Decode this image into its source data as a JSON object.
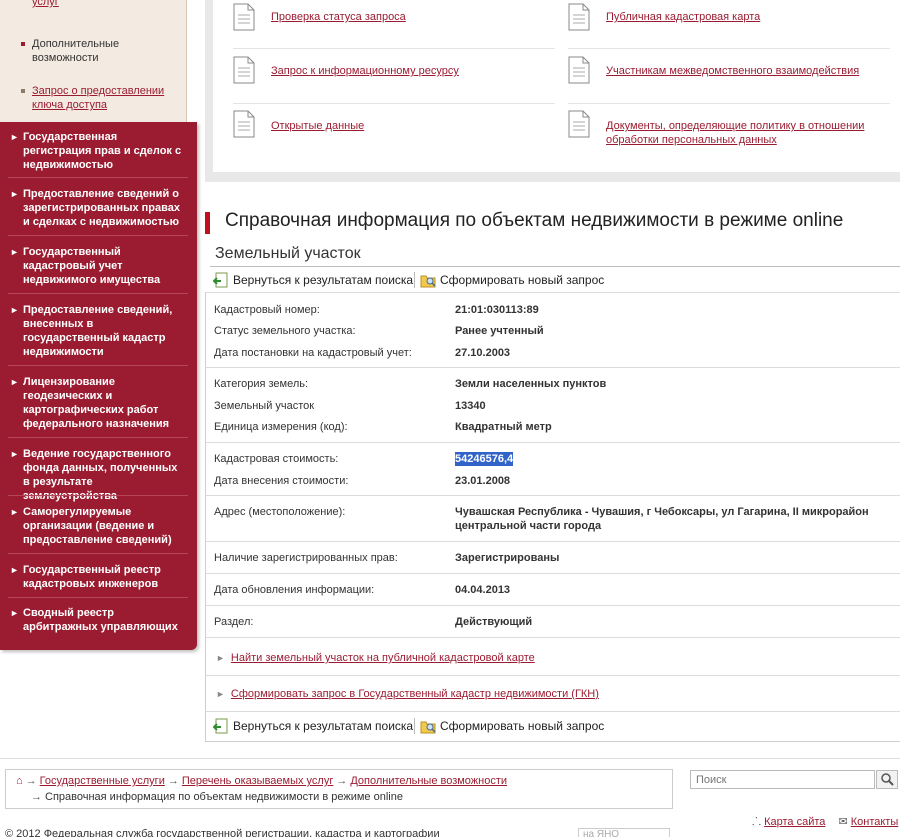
{
  "sidebar": {
    "sub_top_link": "услуг",
    "sub_items": [
      {
        "label": "Дополнительные возможности"
      },
      {
        "label": "Запрос о предоставлении ключа доступа"
      }
    ],
    "nav_items": [
      {
        "label": "Государственная регистрация прав и сделок с недвижимостью"
      },
      {
        "label": "Предоставление сведений о зарегистрированных правах и сделках с недвижимостью"
      },
      {
        "label": "Государственный кадастровый учет недвижимого имущества"
      },
      {
        "label": "Предоставление сведений, внесенных в государственный кадастр недвижимости"
      },
      {
        "label": "Лицензирование геодезических и картографических работ федерального назначения"
      },
      {
        "label": "Ведение государственного фонда данных, полученных в результате землеустройства"
      },
      {
        "label": "Саморегулируемые организации (ведение и предоставление сведений)"
      },
      {
        "label": "Государственный реестр кадастровых инженеров"
      },
      {
        "label": "Сводный реестр арбитражных управляющих"
      }
    ]
  },
  "top_links": [
    {
      "label": "Проверка статуса запроса"
    },
    {
      "label": "Публичная кадастровая карта"
    },
    {
      "label": "Запрос к информационному ресурсу"
    },
    {
      "label": "Участникам межведомственного взаимодействия"
    },
    {
      "label": "Открытые данные"
    },
    {
      "label": "Документы, определяющие политику в отношении обработки персональных данных"
    }
  ],
  "main": {
    "title": "Справочная информация по объектам недвижимости в режиме online",
    "subtitle": "Земельный участок",
    "toolbar": {
      "back_label": "Вернуться к результатам поиска",
      "new_request_label": "Сформировать новый запрос"
    },
    "rows": [
      {
        "key": "Кадастровый номер:",
        "value": "21:01:030113:89"
      },
      {
        "key": "Статус земельного участка:",
        "value": "Ранее учтенный"
      },
      {
        "key": "Дата постановки на кадастровый учет:",
        "value": "27.10.2003"
      },
      {
        "key": "Категория земель:",
        "value": "Земли населенных пунктов"
      },
      {
        "key": "Земельный участок",
        "value": "13340"
      },
      {
        "key": "Единица измерения (код):",
        "value": "Квадратный метр"
      },
      {
        "key": "Кадастровая стоимость:",
        "value": "54246576,4"
      },
      {
        "key": "Дата внесения стоимости:",
        "value": "23.01.2008"
      },
      {
        "key": "Адрес (местоположение):",
        "value": "Чувашская Республика - Чувашия, г Чебоксары, ул Гагарина, II микрорайон центральной части города"
      },
      {
        "key": "Наличие зарегистрированных прав:",
        "value": "Зарегистрированы"
      },
      {
        "key": "Дата обновления информации:",
        "value": "04.04.2013"
      },
      {
        "key": "Раздел:",
        "value": "Действующий"
      }
    ],
    "ext_links": [
      {
        "label": "Найти земельный участок на публичной кадастровой карте"
      },
      {
        "label": "Сформировать запрос в Государственный кадастр недвижимости (ГКН)"
      }
    ]
  },
  "footer": {
    "breadcrumb": [
      {
        "label": "Государственные услуги"
      },
      {
        "label": "Перечень оказываемых услуг"
      },
      {
        "label": "Дополнительные возможности"
      }
    ],
    "current_page": "Справочная информация по объектам недвижимости в режиме online",
    "search_placeholder": "Поиск",
    "sitemap_label": "Карта сайта",
    "contacts_label": "Контакты",
    "copyright": "© 2012 Федеральная служба государственной регистрации, кадастра и картографии",
    "lang_placeholder": "на ЯНО"
  },
  "colors": {
    "accent": "#9b1c31",
    "title_marker": "#c0101f",
    "highlight": "#3163c9"
  }
}
